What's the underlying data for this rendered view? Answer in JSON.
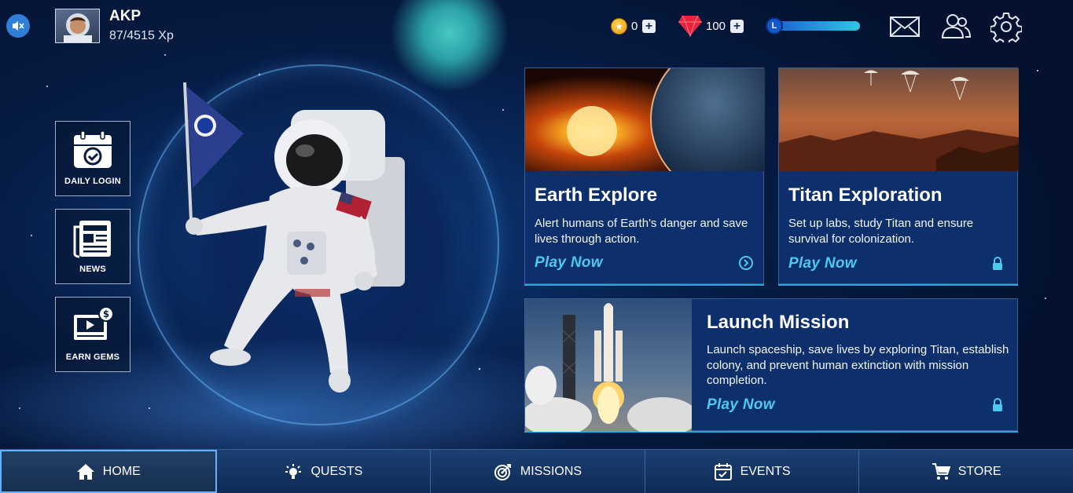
{
  "player": {
    "name": "AKP",
    "xp": "87/4515 Xp"
  },
  "currency": {
    "coins": "0",
    "gems": "100",
    "level_badge": "L"
  },
  "icons": {
    "mute": "speaker-mute-icon",
    "mail": "mail-icon",
    "friends": "friends-icon",
    "settings": "gear-icon"
  },
  "side_menu": [
    {
      "label": "DAILY LOGIN",
      "icon": "calendar-check-icon"
    },
    {
      "label": "NEWS",
      "icon": "newspaper-icon"
    },
    {
      "label": "EARN GEMS",
      "icon": "video-reward-icon"
    }
  ],
  "cards": {
    "earth": {
      "title": "Earth Explore",
      "description": "Alert humans of Earth's danger and save lives through action.",
      "play": "Play Now",
      "status_icon": "arrow-right-circle-icon"
    },
    "titan": {
      "title": "Titan Exploration",
      "description": "Set up labs, study Titan and ensure survival for colonization.",
      "play": "Play Now",
      "status_icon": "lock-icon"
    },
    "launch": {
      "title": "Launch Mission",
      "description": "Launch spaceship, save lives by exploring Titan, establish colony, and prevent human extinction with mission completion.",
      "play": "Play Now",
      "status_icon": "lock-icon"
    }
  },
  "nav": [
    {
      "label": "HOME",
      "icon": "home-icon",
      "active": true
    },
    {
      "label": "QUESTS",
      "icon": "lightbulb-icon",
      "active": false
    },
    {
      "label": "MISSIONS",
      "icon": "target-icon",
      "active": false
    },
    {
      "label": "EVENTS",
      "icon": "calendar-icon",
      "active": false
    },
    {
      "label": "STORE",
      "icon": "cart-icon",
      "active": false
    }
  ],
  "colors": {
    "accent": "#4cc9ee",
    "card_bg": "#0d2f6b",
    "nav_active_border": "#63b2ff"
  }
}
